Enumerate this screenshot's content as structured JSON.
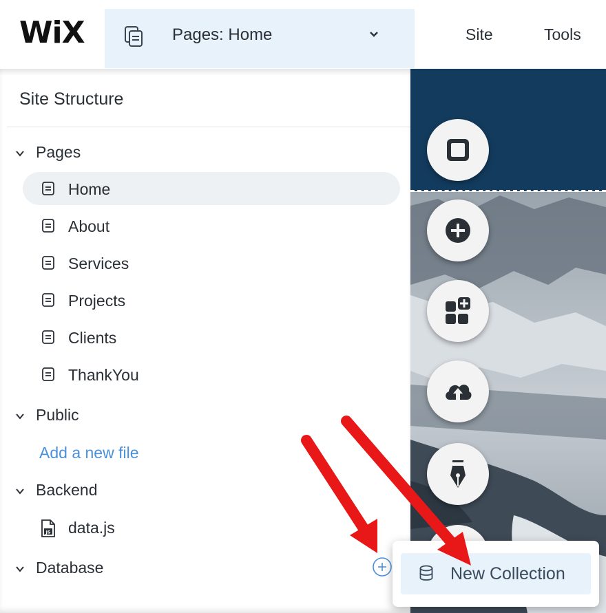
{
  "topbar": {
    "logo": "WiX",
    "pages_dropdown_label": "Pages: Home",
    "menu": [
      "Site",
      "Tools"
    ]
  },
  "panel": {
    "title": "Site Structure",
    "sections": {
      "pages": "Pages",
      "public": "Public",
      "backend": "Backend",
      "database": "Database"
    },
    "pages": [
      "Home",
      "About",
      "Services",
      "Projects",
      "Clients",
      "ThankYou"
    ],
    "selected_page": "Home",
    "add_new_file": "Add a new file",
    "backend_files": [
      "data.js"
    ]
  },
  "popup": {
    "new_collection_label": "New Collection"
  },
  "tool_buttons": [
    "background-icon",
    "add-icon",
    "add-apps-icon",
    "upload-icon",
    "design-pen-icon"
  ],
  "colors": {
    "accent_light": "#e7f2fb",
    "link": "#4a90d9",
    "header_strip": "#133b5e",
    "arrow": "#e81818"
  }
}
